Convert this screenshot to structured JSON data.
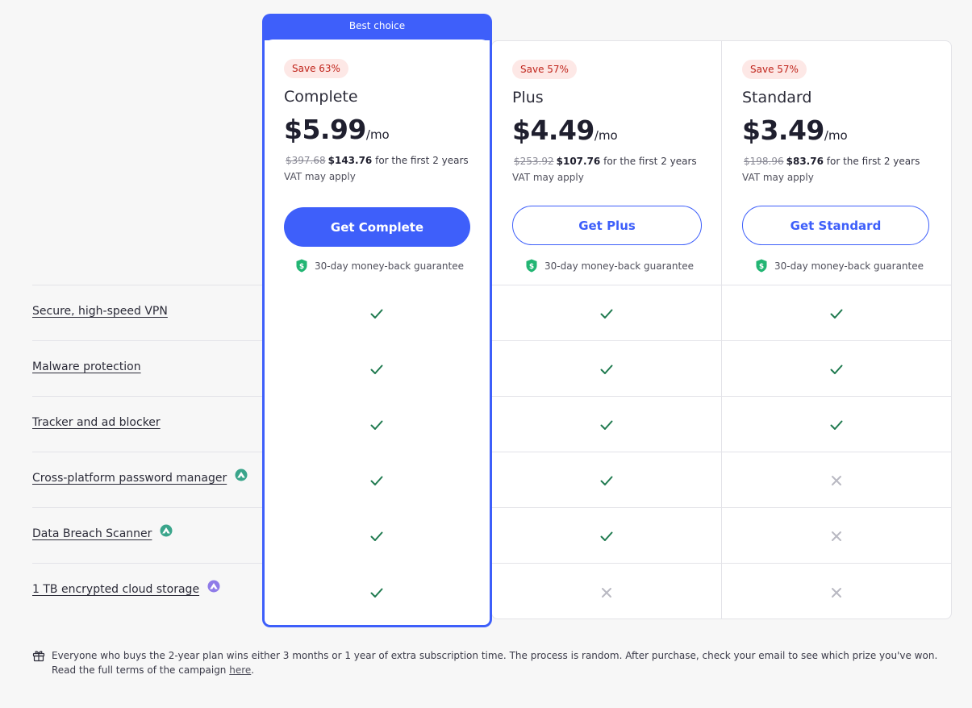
{
  "best_choice_label": "Best choice",
  "plans": [
    {
      "save_badge": "Save 63%",
      "name": "Complete",
      "price": "$5.99",
      "period": "/mo",
      "old_price": "$397.68",
      "new_price": "$143.76",
      "billing_suffix": "for the first 2 years",
      "vat": "VAT may apply",
      "cta": "Get Complete",
      "guarantee": "30-day money-back guarantee"
    },
    {
      "save_badge": "Save 57%",
      "name": "Plus",
      "price": "$4.49",
      "period": "/mo",
      "old_price": "$253.92",
      "new_price": "$107.76",
      "billing_suffix": "for the first 2 years",
      "vat": "VAT may apply",
      "cta": "Get Plus",
      "guarantee": "30-day money-back guarantee"
    },
    {
      "save_badge": "Save 57%",
      "name": "Standard",
      "price": "$3.49",
      "period": "/mo",
      "old_price": "$198.96",
      "new_price": "$83.76",
      "billing_suffix": "for the first 2 years",
      "vat": "VAT may apply",
      "cta": "Get Standard",
      "guarantee": "30-day money-back guarantee"
    }
  ],
  "features": [
    {
      "label": "Secure, high-speed VPN",
      "app_icon": null,
      "included": [
        true,
        true,
        true
      ]
    },
    {
      "label": "Malware protection",
      "app_icon": null,
      "included": [
        true,
        true,
        true
      ]
    },
    {
      "label": "Tracker and ad blocker",
      "app_icon": null,
      "included": [
        true,
        true,
        true
      ]
    },
    {
      "label": "Cross-platform password manager",
      "app_icon": "nordpass-icon",
      "included": [
        true,
        true,
        false
      ]
    },
    {
      "label": "Data Breach Scanner",
      "app_icon": "nordpass-icon",
      "included": [
        true,
        true,
        false
      ]
    },
    {
      "label": "1 TB encrypted cloud storage",
      "app_icon": "nordlocker-icon",
      "included": [
        true,
        false,
        false
      ]
    }
  ],
  "footer": {
    "text": "Everyone who buys the 2-year plan wins either 3 months or 1 year of extra subscription time. The process is random. After purchase, check your email to see which prize you've won. Read the full terms of the campaign ",
    "link_text": "here",
    "end": "."
  },
  "colors": {
    "accent": "#3e5ffa",
    "check": "#1f7a4f",
    "cross": "#b9b9c2",
    "badge_bg": "#fde8e6",
    "badge_text": "#c0241b",
    "shield": "#22b573",
    "nordpass": "#3aa58b",
    "nordlocker": "#8f7be8"
  }
}
